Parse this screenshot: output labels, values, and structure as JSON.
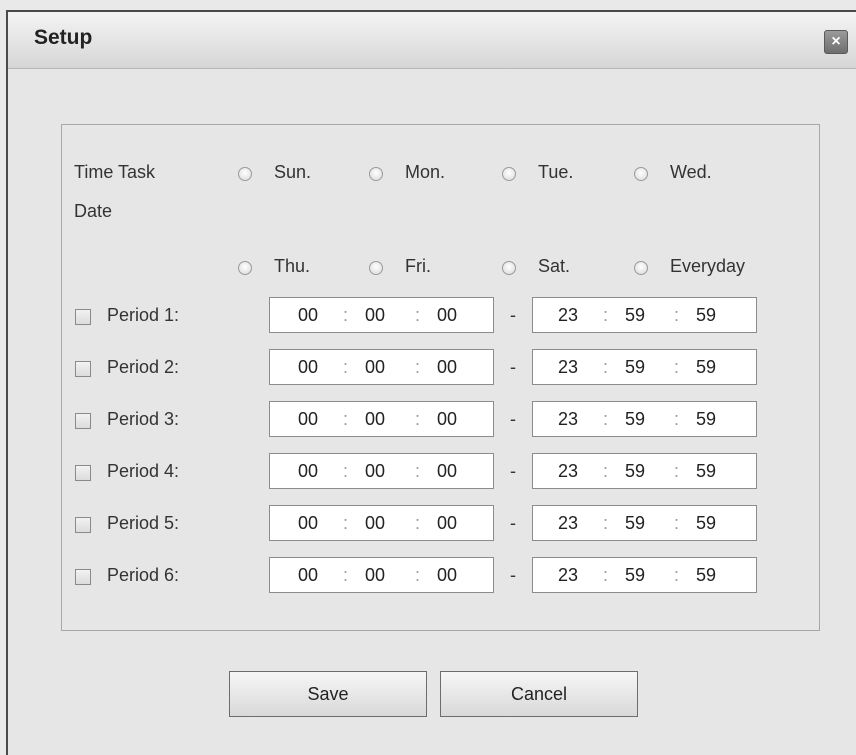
{
  "dialog": {
    "title": "Setup",
    "close_label": "×"
  },
  "form": {
    "time_task_label": "Time Task",
    "date_label": "Date",
    "days": [
      "Sun.",
      "Mon.",
      "Tue.",
      "Wed.",
      "Thu.",
      "Fri.",
      "Sat.",
      "Everyday"
    ],
    "dash": "-",
    "colon": ":",
    "periods": [
      {
        "label": "Period 1:",
        "start": [
          "00",
          "00",
          "00"
        ],
        "end": [
          "23",
          "59",
          "59"
        ]
      },
      {
        "label": "Period 2:",
        "start": [
          "00",
          "00",
          "00"
        ],
        "end": [
          "23",
          "59",
          "59"
        ]
      },
      {
        "label": "Period 3:",
        "start": [
          "00",
          "00",
          "00"
        ],
        "end": [
          "23",
          "59",
          "59"
        ]
      },
      {
        "label": "Period 4:",
        "start": [
          "00",
          "00",
          "00"
        ],
        "end": [
          "23",
          "59",
          "59"
        ]
      },
      {
        "label": "Period 5:",
        "start": [
          "00",
          "00",
          "00"
        ],
        "end": [
          "23",
          "59",
          "59"
        ]
      },
      {
        "label": "Period 6:",
        "start": [
          "00",
          "00",
          "00"
        ],
        "end": [
          "23",
          "59",
          "59"
        ]
      }
    ]
  },
  "buttons": {
    "save_label": "Save",
    "cancel_label": "Cancel"
  }
}
